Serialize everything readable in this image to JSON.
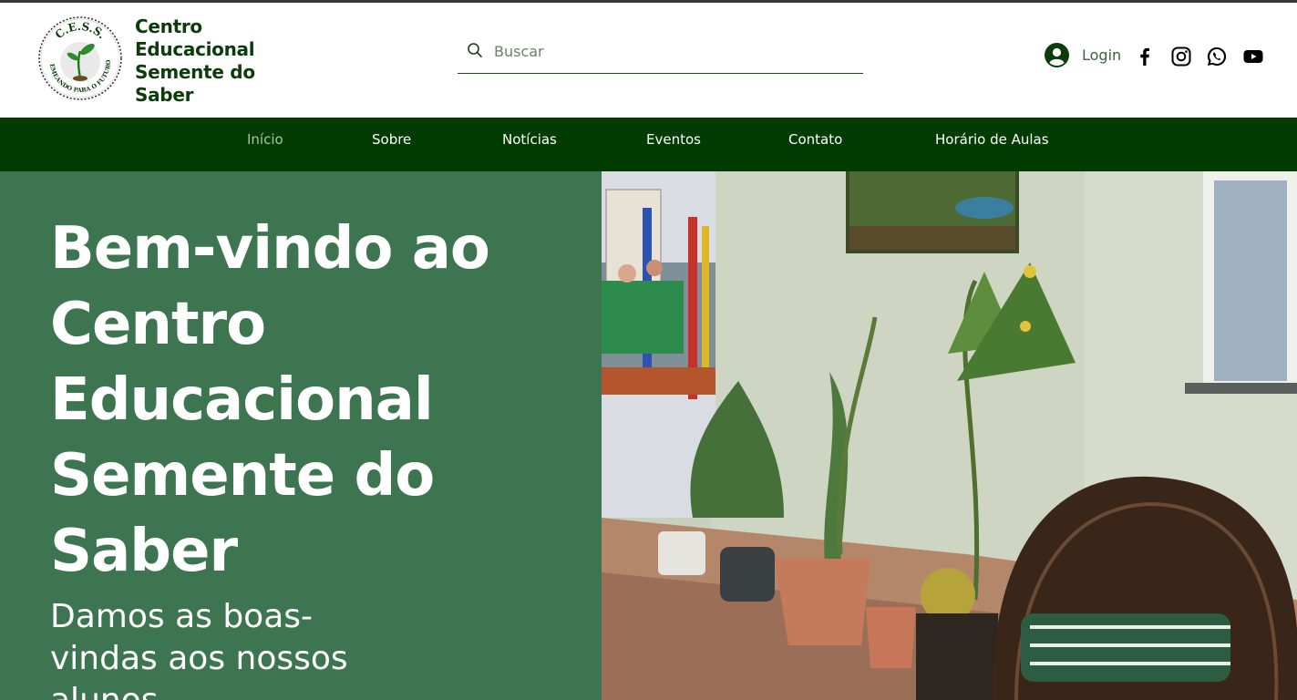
{
  "brand": {
    "logo_alt": "C.E.S.S. Semeando para o futuro",
    "logo_ring_top": "C.E.S.S.",
    "logo_ring_bottom": "SEMEANDO PARA O FUTURO",
    "name_lines": [
      "Centro",
      "Educacional",
      "Semente do",
      "Saber"
    ]
  },
  "search": {
    "placeholder": "Buscar",
    "value": ""
  },
  "header": {
    "login_label": "Login"
  },
  "social": [
    {
      "name": "facebook-icon"
    },
    {
      "name": "instagram-icon"
    },
    {
      "name": "whatsapp-icon"
    },
    {
      "name": "youtube-icon"
    }
  ],
  "nav": {
    "items": [
      "Início",
      "Sobre",
      "Notícias",
      "Eventos",
      "Contato",
      "Horário de Aulas"
    ],
    "active": "Início"
  },
  "hero": {
    "title_lines": [
      "Bem-vindo ao",
      "Centro",
      "Educacional",
      "Semente do",
      "Saber"
    ],
    "subtitle_lines": [
      "Damos as boas-",
      "vindas aos nossos",
      "alunos"
    ],
    "image_alt": "Hall da escola com plantas e cadeira"
  },
  "colors": {
    "brand_green": "#0c3b0c",
    "nav_bg": "#033c03",
    "hero_bg": "#3c7550",
    "nav_active": "#a7c3a7"
  }
}
